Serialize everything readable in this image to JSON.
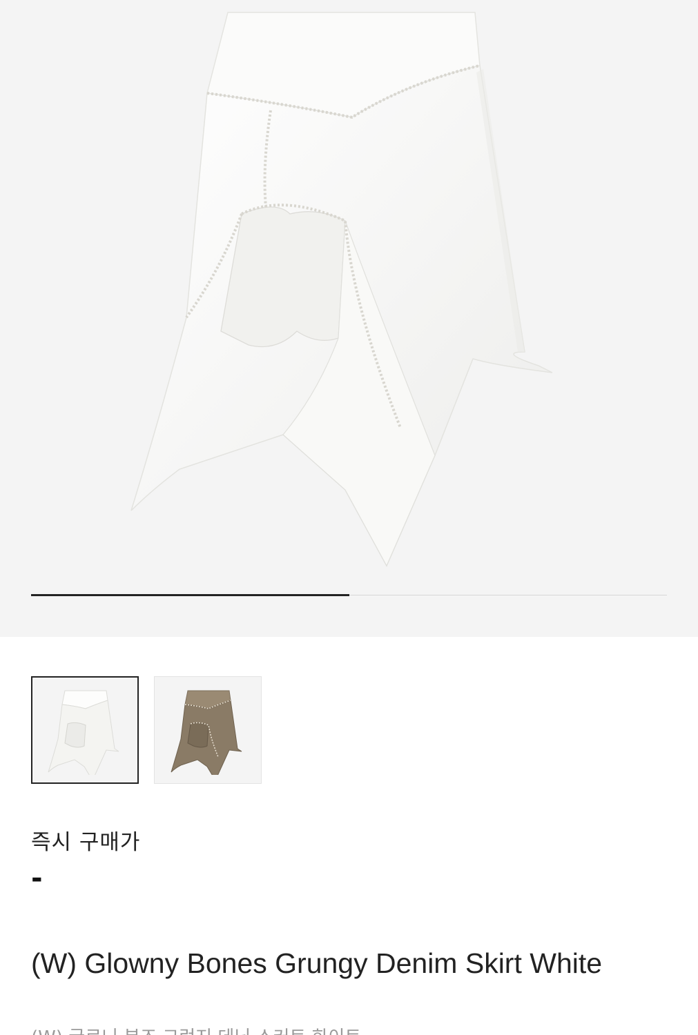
{
  "product": {
    "title": "(W) Glowny Bones Grungy Denim Skirt White",
    "subtitle_partial": "(W) 글로니 본즈 그런지 데님 스커트 화이트"
  },
  "gallery": {
    "progress_fraction": 0.5,
    "colors": {
      "background": "#f4f4f4",
      "indicator_active": "#222222",
      "indicator_track": "#d6d6d6"
    }
  },
  "thumbnails": [
    {
      "color_name": "white",
      "swatch": "#f5f4f0",
      "selected": true
    },
    {
      "color_name": "khaki",
      "swatch": "#8a7b66",
      "selected": false
    }
  ],
  "price": {
    "label": "즉시 구매가",
    "value": "-"
  }
}
